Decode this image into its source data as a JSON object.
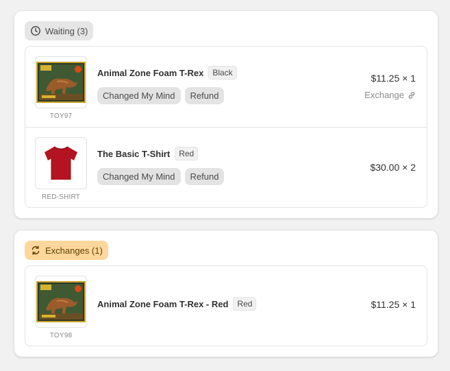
{
  "colors": {
    "waiting_badge_bg": "#e6e6e6",
    "exchanges_badge_bg": "#ffd69c",
    "tag_bg": "#e3e3e3"
  },
  "waiting": {
    "badge": {
      "icon": "clock-icon",
      "label": "Waiting (3)"
    },
    "items": [
      {
        "title": "Animal Zone Foam T-Rex",
        "variant": "Black",
        "sku": "TOY97",
        "tags": [
          "Changed My Mind",
          "Refund"
        ],
        "price": "$11.25 × 1",
        "exchange_label": "Exchange",
        "image": "dinosaur-toy-box"
      },
      {
        "title": "The Basic T-Shirt",
        "variant": "Red",
        "sku": "RED-SHIRT",
        "tags": [
          "Changed My Mind",
          "Refund"
        ],
        "price": "$30.00 × 2",
        "image": "red-t-shirt"
      }
    ]
  },
  "exchanges": {
    "badge": {
      "icon": "exchange-arrows-icon",
      "label": "Exchanges (1)"
    },
    "items": [
      {
        "title": "Animal Zone Foam T-Rex - Red",
        "variant": "Red",
        "sku": "TOY98",
        "price": "$11.25 × 1",
        "image": "dinosaur-toy-box"
      }
    ]
  }
}
